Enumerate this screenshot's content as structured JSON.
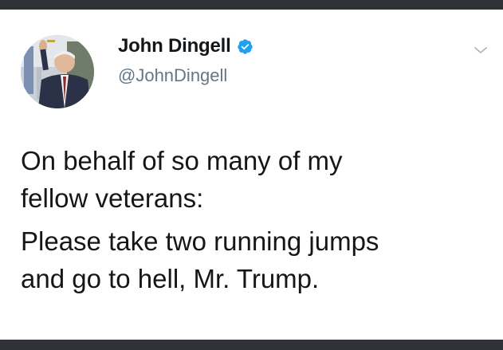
{
  "colors": {
    "background": "#2f3337",
    "card": "#ffffff",
    "name_text": "#14171a",
    "handle_text": "#657786",
    "verified_badge": "#1da1f2",
    "chevron": "#aab8c2"
  },
  "icons": {
    "verified": "verified-badge-icon",
    "menu": "chevron-down-icon"
  },
  "author": {
    "display_name": "John Dingell",
    "handle": "@JohnDingell",
    "verified": true
  },
  "tweet": {
    "paragraphs": [
      "On behalf of so many of my\nfellow veterans:",
      "Please take two running jumps\nand go to hell, Mr. Trump."
    ]
  }
}
